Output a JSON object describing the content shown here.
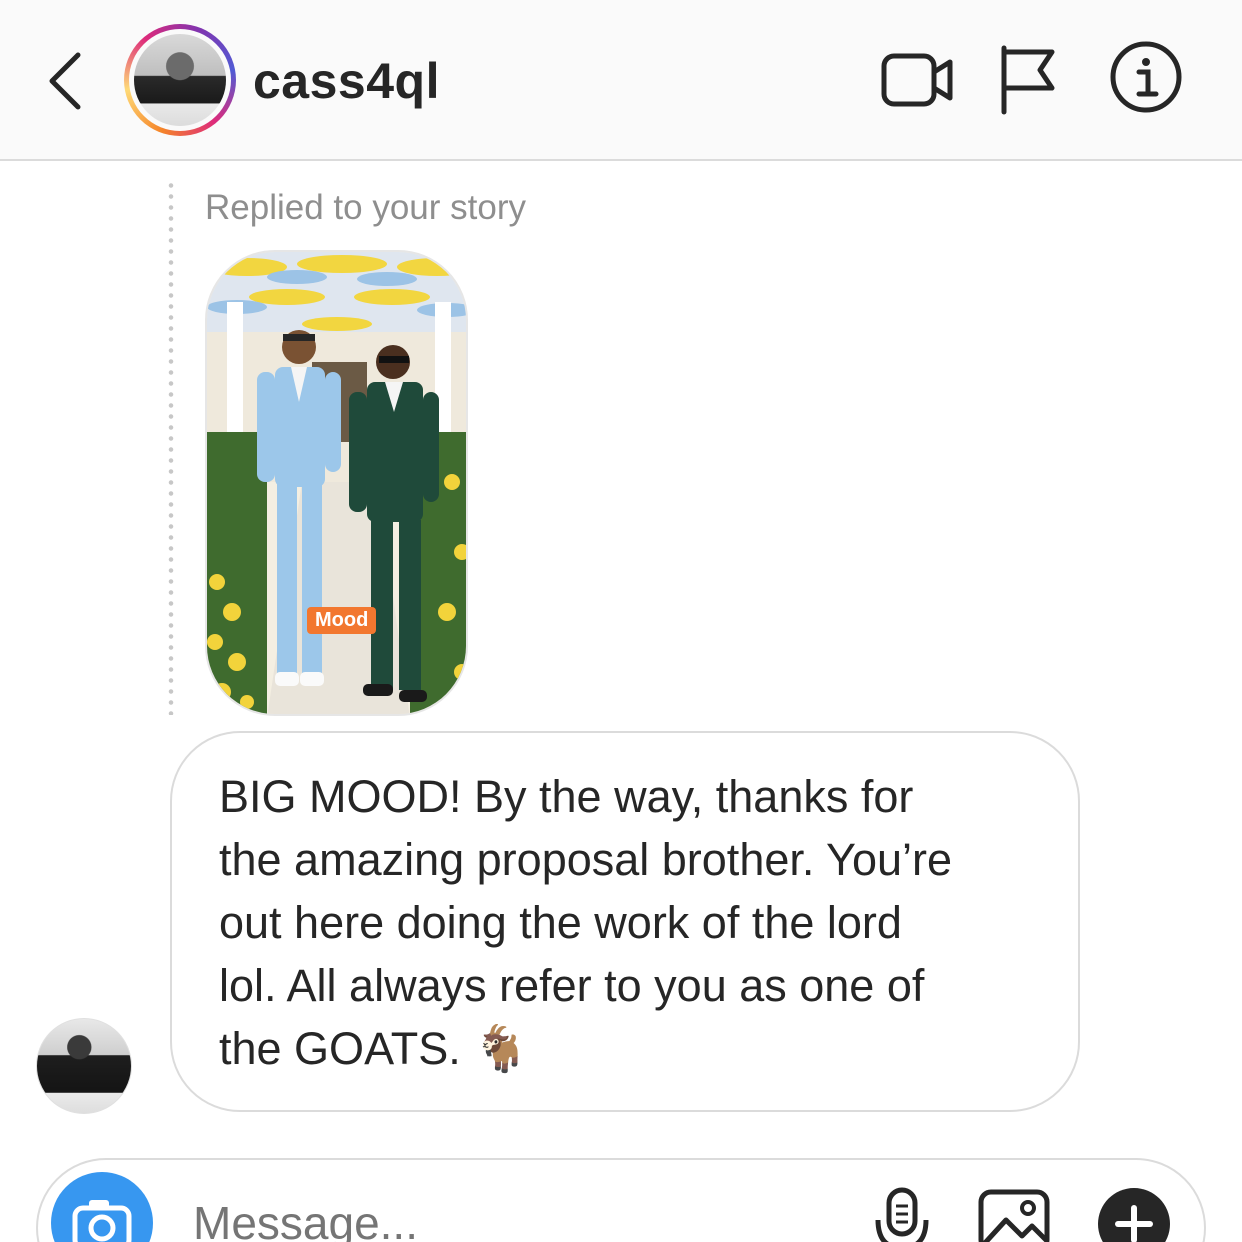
{
  "header": {
    "username": "cass4ql",
    "icons": [
      "chevron-left-icon",
      "video-camera-icon",
      "flag-icon",
      "info-icon"
    ]
  },
  "thread": {
    "reply_label": "Replied to your story",
    "story_sticker": "Mood",
    "message_lines": [
      "BIG MOOD! By the way, thanks for",
      "the amazing proposal brother. You’re",
      "out here doing the work of the lord",
      "lol. All always refer to you as one of",
      "the GOATS. 🐐"
    ]
  },
  "composer": {
    "placeholder": "Message...",
    "icons": [
      "camera-icon",
      "microphone-icon",
      "gallery-icon",
      "plus-icon"
    ],
    "accent": "#3797f0"
  }
}
